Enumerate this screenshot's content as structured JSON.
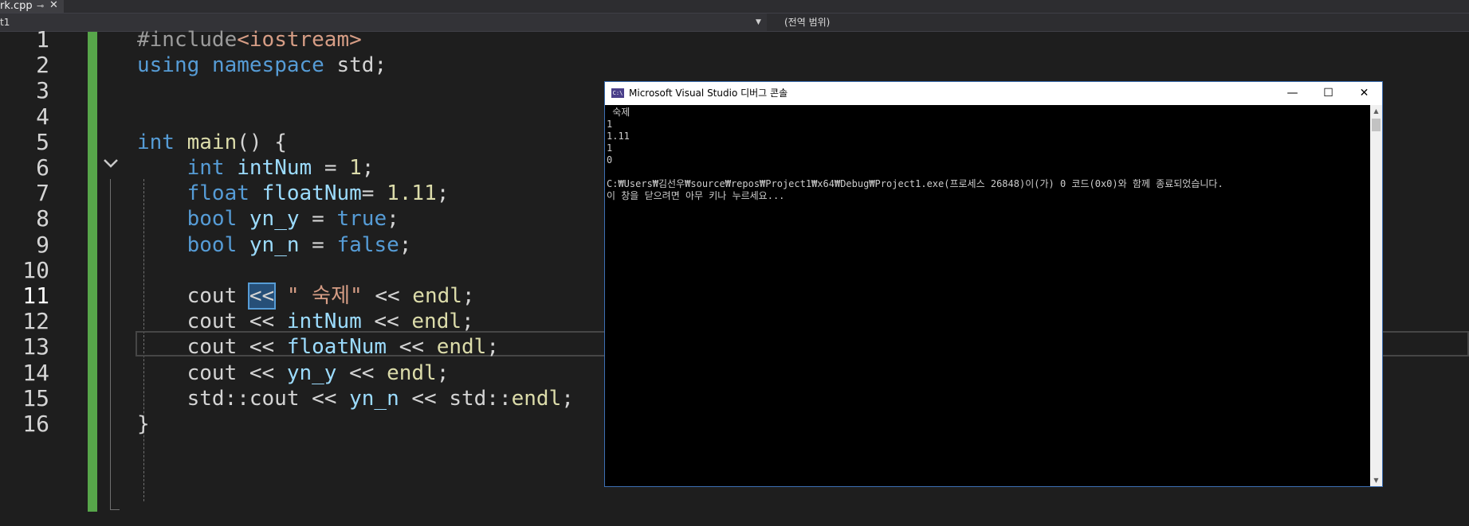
{
  "tab": {
    "filename": "rk.cpp",
    "pin_glyph": "⊸",
    "close_glyph": "✕"
  },
  "navbar": {
    "left_value": "t1",
    "right_value": "(전역 범위)"
  },
  "editor": {
    "line_numbers": [
      "1",
      "2",
      "3",
      "4",
      "5",
      "6",
      "7",
      "8",
      "9",
      "10",
      "11",
      "12",
      "13",
      "14",
      "15",
      "16"
    ],
    "active_line": "11",
    "lines": [
      [
        {
          "t": "#include",
          "c": "pp"
        },
        {
          "t": "<iostream>",
          "c": "str"
        }
      ],
      [
        {
          "t": "using",
          "c": "kw"
        },
        {
          "t": " ",
          "c": "plain"
        },
        {
          "t": "namespace",
          "c": "kw"
        },
        {
          "t": " std;",
          "c": "plain"
        }
      ],
      [],
      [],
      [
        {
          "t": "int",
          "c": "kw"
        },
        {
          "t": " ",
          "c": "plain"
        },
        {
          "t": "main",
          "c": "fn"
        },
        {
          "t": "() {",
          "c": "plain"
        }
      ],
      [
        {
          "t": "    ",
          "c": "plain"
        },
        {
          "t": "int",
          "c": "kw"
        },
        {
          "t": " ",
          "c": "plain"
        },
        {
          "t": "intNum",
          "c": "var"
        },
        {
          "t": " = ",
          "c": "plain"
        },
        {
          "t": "1",
          "c": "fn"
        },
        {
          "t": ";",
          "c": "plain"
        }
      ],
      [
        {
          "t": "    ",
          "c": "plain"
        },
        {
          "t": "float",
          "c": "kw"
        },
        {
          "t": " ",
          "c": "plain"
        },
        {
          "t": "floatNum",
          "c": "var"
        },
        {
          "t": "= ",
          "c": "plain"
        },
        {
          "t": "1.11",
          "c": "fn"
        },
        {
          "t": ";",
          "c": "plain"
        }
      ],
      [
        {
          "t": "    ",
          "c": "plain"
        },
        {
          "t": "bool",
          "c": "kw"
        },
        {
          "t": " ",
          "c": "plain"
        },
        {
          "t": "yn_y",
          "c": "var"
        },
        {
          "t": " = ",
          "c": "plain"
        },
        {
          "t": "true",
          "c": "kw"
        },
        {
          "t": ";",
          "c": "plain"
        }
      ],
      [
        {
          "t": "    ",
          "c": "plain"
        },
        {
          "t": "bool",
          "c": "kw"
        },
        {
          "t": " ",
          "c": "plain"
        },
        {
          "t": "yn_n",
          "c": "var"
        },
        {
          "t": " = ",
          "c": "plain"
        },
        {
          "t": "false",
          "c": "kw"
        },
        {
          "t": ";",
          "c": "plain"
        }
      ],
      [],
      [
        {
          "t": "    cout ",
          "c": "plain"
        },
        {
          "t": "<<",
          "c": "sel-op"
        },
        {
          "t": " ",
          "c": "plain"
        },
        {
          "t": "\" 숙제\"",
          "c": "str"
        },
        {
          "t": " << ",
          "c": "plain"
        },
        {
          "t": "endl",
          "c": "fn"
        },
        {
          "t": ";",
          "c": "plain"
        }
      ],
      [
        {
          "t": "    cout << ",
          "c": "plain"
        },
        {
          "t": "intNum",
          "c": "var"
        },
        {
          "t": " << ",
          "c": "plain"
        },
        {
          "t": "endl",
          "c": "fn"
        },
        {
          "t": ";",
          "c": "plain"
        }
      ],
      [
        {
          "t": "    cout << ",
          "c": "plain"
        },
        {
          "t": "floatNum",
          "c": "var"
        },
        {
          "t": " << ",
          "c": "plain"
        },
        {
          "t": "endl",
          "c": "fn"
        },
        {
          "t": ";",
          "c": "plain"
        }
      ],
      [
        {
          "t": "    cout << ",
          "c": "plain"
        },
        {
          "t": "yn_y",
          "c": "var"
        },
        {
          "t": " << ",
          "c": "plain"
        },
        {
          "t": "endl",
          "c": "fn"
        },
        {
          "t": ";",
          "c": "plain"
        }
      ],
      [
        {
          "t": "    std::cout << ",
          "c": "plain"
        },
        {
          "t": "yn_n",
          "c": "var"
        },
        {
          "t": " << std::",
          "c": "plain"
        },
        {
          "t": "endl",
          "c": "fn"
        },
        {
          "t": ";",
          "c": "plain"
        }
      ],
      [
        {
          "t": "}",
          "c": "plain"
        }
      ]
    ]
  },
  "console": {
    "title": "Microsoft Visual Studio 디버그 콘솔",
    "app_icon_text": "C:\\",
    "min_glyph": "—",
    "max_glyph": "☐",
    "close_glyph": "✕",
    "output_lines": [
      " 숙제",
      "1",
      "1.11",
      "1",
      "0",
      "",
      "C:₩Users₩김선우₩source₩repos₩Project1₩x64₩Debug₩Project1.exe(프로세스 26848)이(가) 0 코드(0x0)와 함께 종료되었습니다.",
      "이 창을 닫으려면 아무 키나 누르세요..."
    ],
    "scroll_up_glyph": "▲",
    "scroll_down_glyph": "▼"
  },
  "colors": {
    "editor_bg": "#1e1e1e",
    "keyword": "#569cd6",
    "string": "#d69d85",
    "function": "#dcdcaa",
    "variable": "#9cdcfe",
    "change_bar": "#57a64a",
    "console_bg": "#000000"
  }
}
